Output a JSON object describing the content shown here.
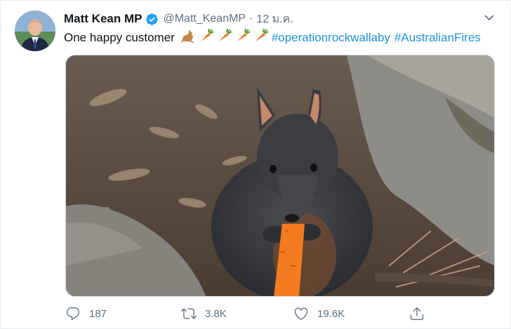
{
  "tweet": {
    "author_name": "Matt Kean MP",
    "handle": "@Matt_KeanMP",
    "separator": "·",
    "time": "12 ม.ค.",
    "text": "One happy customer",
    "emojis": [
      "kangaroo",
      "carrot",
      "carrot",
      "carrot",
      "carrot"
    ],
    "hashtag_1": "#operationrockwallaby",
    "hashtag_2": "#AustralianFires",
    "media_description": "rock wallaby eating a carrot"
  },
  "actions": {
    "replies": "187",
    "retweets": "3.8K",
    "likes": "19.6K"
  },
  "colors": {
    "link": "#1b95e0",
    "secondary_text": "#5b7083",
    "verified": "#1da1f2",
    "carrot": "#f47b20"
  },
  "icons": [
    "verified-badge-icon",
    "chevron-down-icon",
    "reply-icon",
    "retweet-icon",
    "like-icon",
    "share-icon"
  ]
}
